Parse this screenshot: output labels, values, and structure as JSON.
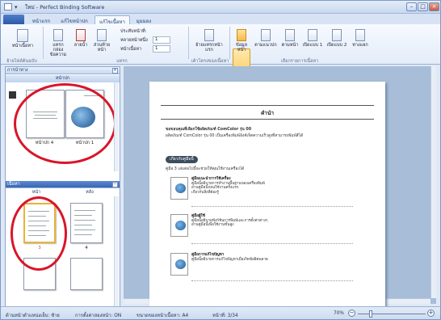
{
  "window": {
    "title": "ใหม่ - Perfect Binding Software"
  },
  "ribbon_tabs": [
    "หน้าแรก",
    "แก้ไขหน้าปก",
    "แก้ไขเนื้อหา",
    "มุมมอง"
  ],
  "ribbon": {
    "buttons": {
      "page_content": "หน้าเนื้อหา",
      "text_box": "แทรกกล่อง\nข้อความ",
      "text": "ลายน้ำ",
      "page_number": "ส่วนท้าย\nหน้า",
      "page_num_format": "ประทับหน้าที่:",
      "page_margin": "หลายหน้าหนึ่ง",
      "content_page_count": "หน้าเนื้อหา",
      "insert_first_page": "ย้ายแทรกหน้าแรก",
      "single_page": "ข้อมูลหน้า",
      "content_one": "ตามแนวปก",
      "content_two": "ตามหน้า",
      "content_three": "เปิดแบบ 1",
      "content_four": "เปิดแบบ 2",
      "content_five": "ทางแยก"
    },
    "spin1": "1",
    "spin2": "1",
    "groups": [
      "ย้ายไฟล์ต้นฉบับ",
      "แทรก",
      "เค้าโครงของเนื้อหา",
      "เลือกรายการเนื้อหา"
    ]
  },
  "left_pane": {
    "navigation_label": "การนำทาง",
    "cover_header": "หน้าปก",
    "cover_pages": [
      "หน้าปก 4",
      "หน้าปก 1"
    ],
    "content_header": "เนื้อหา",
    "content_tabs": [
      "หน้า",
      "หลัง"
    ],
    "content_pages": [
      "3",
      "4"
    ]
  },
  "document": {
    "title": "คำนำ",
    "intro_line1": "ขอขอบคุณที่เลือกใช้ผลิตภัณฑ์ ComColor รุ่น 00",
    "intro_line2": "ผลิตภัณฑ์ ComColor รุ่น 00 เป็นเครื่องพิมพ์อิงค์เจ็ตความเร็วสูงที่สามารถพิมพ์สีได้",
    "section_label": "เกี่ยวกับคู่มือนี้",
    "section_sub": "คู่มือ 3 เล่มต่อไปนี้จะช่วยให้คุณใช้งานเครื่องได้",
    "items": [
      {
        "head": "คู่มือแนะนำการใช้เครื่อง",
        "l1": "คู่มือนี้อธิบายการทำงานพื้นฐานของเครื่องพิมพ์",
        "l2": "อ่านคู่มือนี้ก่อนใช้งานครั้งแรก",
        "l3": "เกี่ยวกับสิ่งที่ต้องรู้"
      },
      {
        "head": "คู่มือผู้ใช้",
        "l1": "คู่มือนี้อธิบายฟังก์ชันการพิมพ์และการตั้งค่าต่างๆ",
        "l2": "อ่านคู่มือนี้เพื่อใช้งานขั้นสูง",
        "l3": ""
      },
      {
        "head": "คู่มือการแก้ไขปัญหา",
        "l1": "คู่มือนี้อธิบายการแก้ไขปัญหาเมื่อเกิดข้อผิดพลาด",
        "l2": "",
        "l3": ""
      }
    ]
  },
  "status": {
    "bind_side": "ด้านหน้าตำแหน่งเย็บ: ซ้าย",
    "duplex": "การตั้งค่าสองหน้า: ON",
    "paper": "ขนาดของหน้าเนื้อหา: A4",
    "page": "หน้าที่: 3/34",
    "zoom": "70%"
  }
}
